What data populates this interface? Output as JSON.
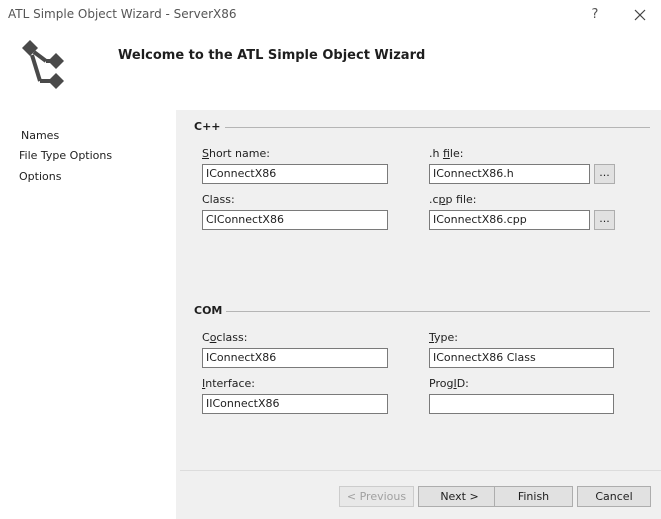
{
  "window": {
    "title": "ATL Simple Object Wizard - ServerX86",
    "help_label": "?"
  },
  "header": {
    "welcome": "Welcome to the ATL Simple Object Wizard"
  },
  "nav": {
    "items": [
      {
        "label": "Names"
      },
      {
        "label": "File Type Options"
      },
      {
        "label": "Options"
      }
    ]
  },
  "cpp": {
    "title": "C++",
    "short_name": {
      "label_pre": "",
      "label_key": "S",
      "label_post": "hort name:",
      "value": "IConnectX86"
    },
    "class": {
      "label": "Class:",
      "value": "CIConnectX86"
    },
    "h_file": {
      "label_pre": ".h ",
      "label_key": "f",
      "label_post": "ile:",
      "value": "IConnectX86.h"
    },
    "cpp_file": {
      "label_pre": ".c",
      "label_key": "p",
      "label_post": "p file:",
      "value": "IConnectX86.cpp"
    },
    "browse_label": "..."
  },
  "com": {
    "title": "COM",
    "coclass": {
      "label_pre": "C",
      "label_key": "o",
      "label_post": "class:",
      "value": "IConnectX86"
    },
    "type": {
      "label_pre": "",
      "label_key": "T",
      "label_post": "ype:",
      "value": "IConnectX86 Class"
    },
    "interface": {
      "label_pre": "",
      "label_key": "I",
      "label_post": "nterface:",
      "value": "IIConnectX86"
    },
    "progid": {
      "label_pre": "Prog",
      "label_key": "I",
      "label_post": "D:",
      "value": ""
    }
  },
  "buttons": {
    "previous": "< Previous",
    "next": "Next >",
    "finish": "Finish",
    "cancel": "Cancel"
  }
}
